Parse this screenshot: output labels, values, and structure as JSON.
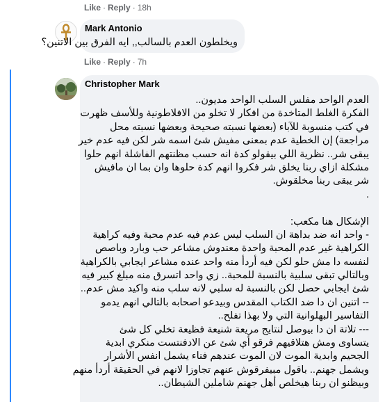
{
  "top_actions": {
    "like": "Like",
    "reply": "Reply",
    "time": "18h"
  },
  "comment1": {
    "author": "Mark Antonio",
    "avatar_icon": "ankh-icon",
    "text": "ويخلطون العدم بالسالب,, ايه الفرق بين الاتنين؟",
    "actions": {
      "like": "Like",
      "reply": "Reply",
      "time": "7h"
    }
  },
  "comment2": {
    "author": "Christopher Mark",
    "avatar_icon": "landscape-photo-avatar",
    "lines": [
      "العدم الواحد مفلس السلب الواحد مديون..",
      "الفكرة الغلط المتاخدة من افكار لا تخلو من الافلاطونية وللأسف ظهرت",
      "في كتب منسوبة للآباء (بعضها نسبته صحيحة وبعضها نسبته محل",
      "مراجعة) إن الخطية عدم بمعنى مفيش شئ اسمه شر لكن فيه عدم خير",
      "يبقى شر.. نظرية اللي بيقولو كدة انه حسب مظنتهم الفاشلة انهم حلوا",
      "مشكلة ازاي ربنا يخلق شر فكروا انهم كدة حلوها وان بما ان مافيش",
      "شر يبقى ربنا مخلقوش.",
      ".",
      "",
      "الإشكال هنا مكعب:",
      "- واحد انه ضد بداهة ان السلب ليس عدم فيه عدم محبة وفيه كراهية",
      "الكراهية غير عدم المحبة واحدة معندوش مشاعر حب وبارد وباصص",
      "لنفسه دا مش حلو لكن فيه أردأ منه واحد عنده مشاعر ايجابي بالكراهية",
      "وبالتالي تبقى سلبية بالنسبة للمحبة.. زي واحد اتسرق منه مبلغ كبير فيه",
      "شئ ايجابي حصل لكن بالنسبة له سلبي لانه سلب منه واكيد مش عدم..",
      "-- اتنين ان دا ضد الكتاب المقدس وبيدعو اصحابه بالتالي انهم يدمو",
      "التفاسير البهلوانية التي ولا بهذا تفلح..",
      "--- تلاتة ان دا بيوصل لنتايج مريعة شنيعة فظيعة تخلي كل شئ",
      "يتساوى ومش هتلاقيهم فرقو أي شئ عن الادفنتست منكري ابدية",
      "الجحيم وابدية الموت لان الموت عندهم فناء يشمل انفس الأشرار",
      "ويشمل جهنم.. باقول مبيفرقوش عنهم تجاوزا لانهم في الحقيقة أردأ منهم",
      "وبيظنو ان ربنا هيخلص أهل جهنم شاملين الشيطان.."
    ]
  }
}
